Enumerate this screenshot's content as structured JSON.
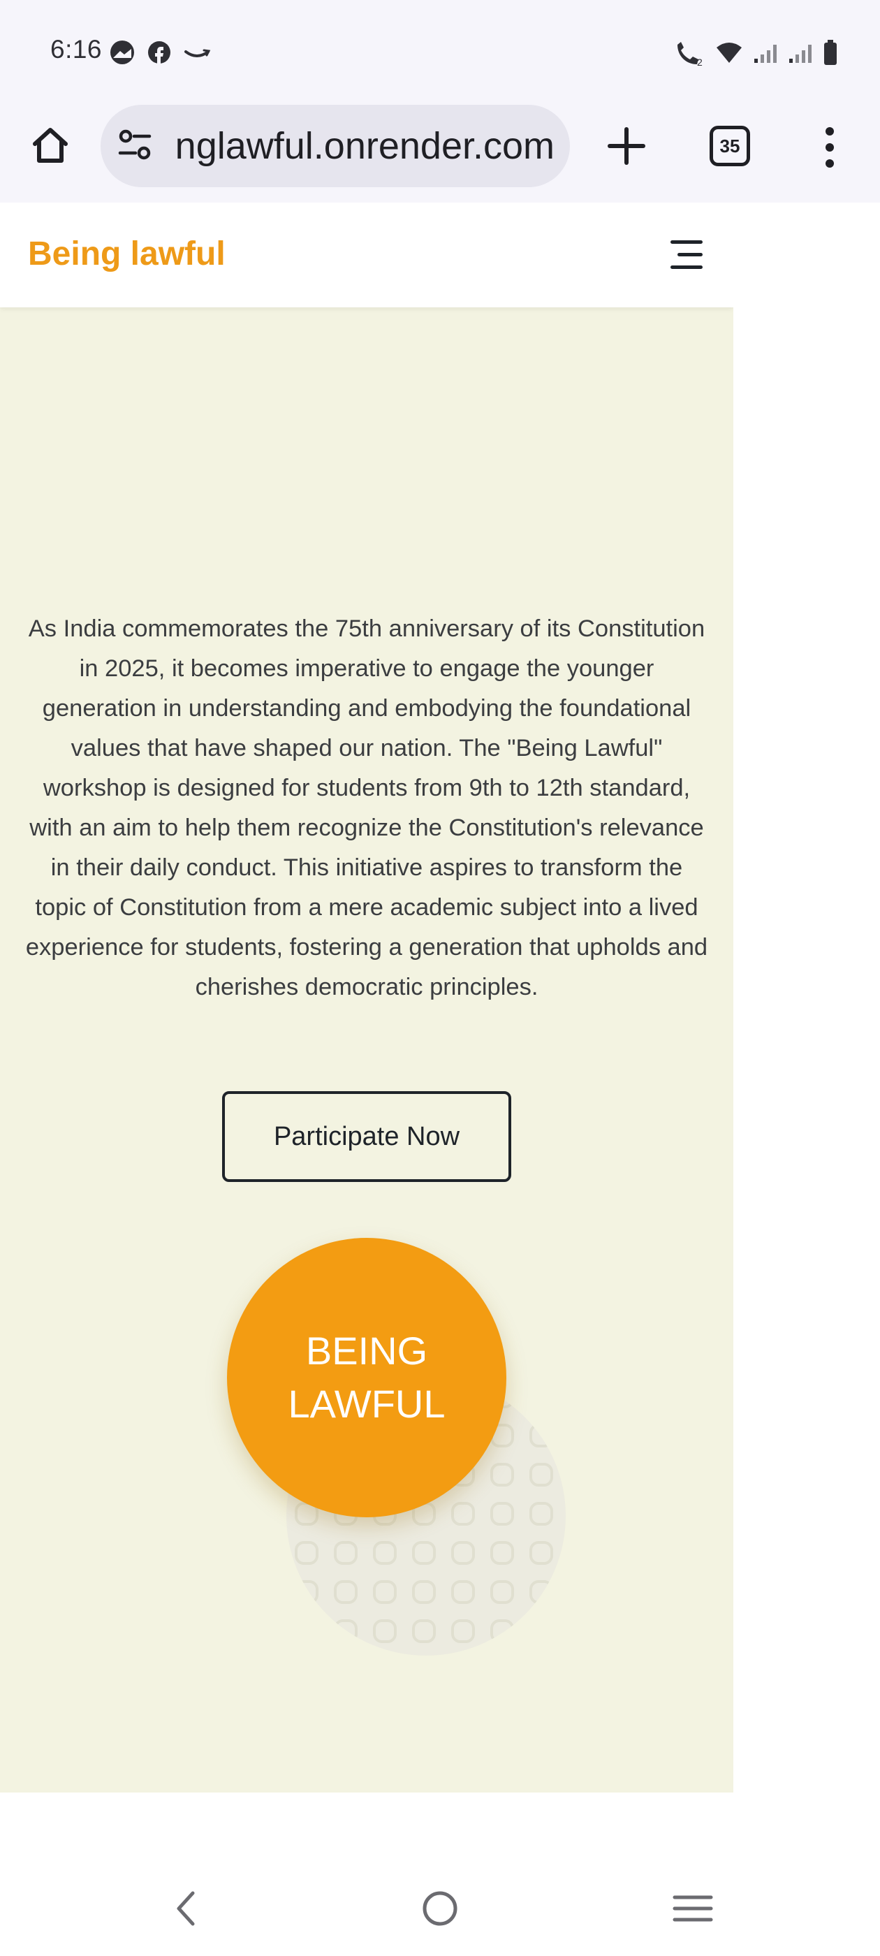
{
  "status_bar": {
    "time": "6:16",
    "left_icons": [
      "gallery-icon",
      "facebook-icon",
      "amazon-icon"
    ],
    "right_icons": [
      "wifi-call-icon",
      "wifi-icon",
      "signal-icon-1",
      "signal-icon-2",
      "battery-icon"
    ],
    "wifi_call_sim": "2"
  },
  "browser": {
    "url": "beinglawful.onrender.com",
    "tab_count": "35",
    "icons": [
      "home-icon",
      "site-settings-icon",
      "plus-icon",
      "more-vert-icon"
    ]
  },
  "site": {
    "brand": "Being lawful",
    "brand_color": "#ee9a18",
    "menu_icon": "hamburger-icon",
    "intro": "As India commemorates the 75th anniversary of its Constitution in 2025, it becomes imperative to engage the younger generation in understanding and embodying the foundational values that have shaped our nation. The \"Being Lawful\" workshop is designed for students from 9th to 12th standard, with an aim to help them recognize the Constitution's relevance in their daily conduct. This initiative aspires to transform the topic of Constitution from a mere academic subject into a lived experience for students, fostering a generation that upholds and cherishes democratic principles.",
    "cta_label": "Participate Now",
    "logo_line1": "BEING",
    "logo_line2": "LAWFUL",
    "logo_color": "#f39c12",
    "background_color": "#f3f3e1"
  },
  "nav_bar": {
    "icons": [
      "back-icon",
      "home-circle-icon",
      "recents-icon"
    ]
  }
}
